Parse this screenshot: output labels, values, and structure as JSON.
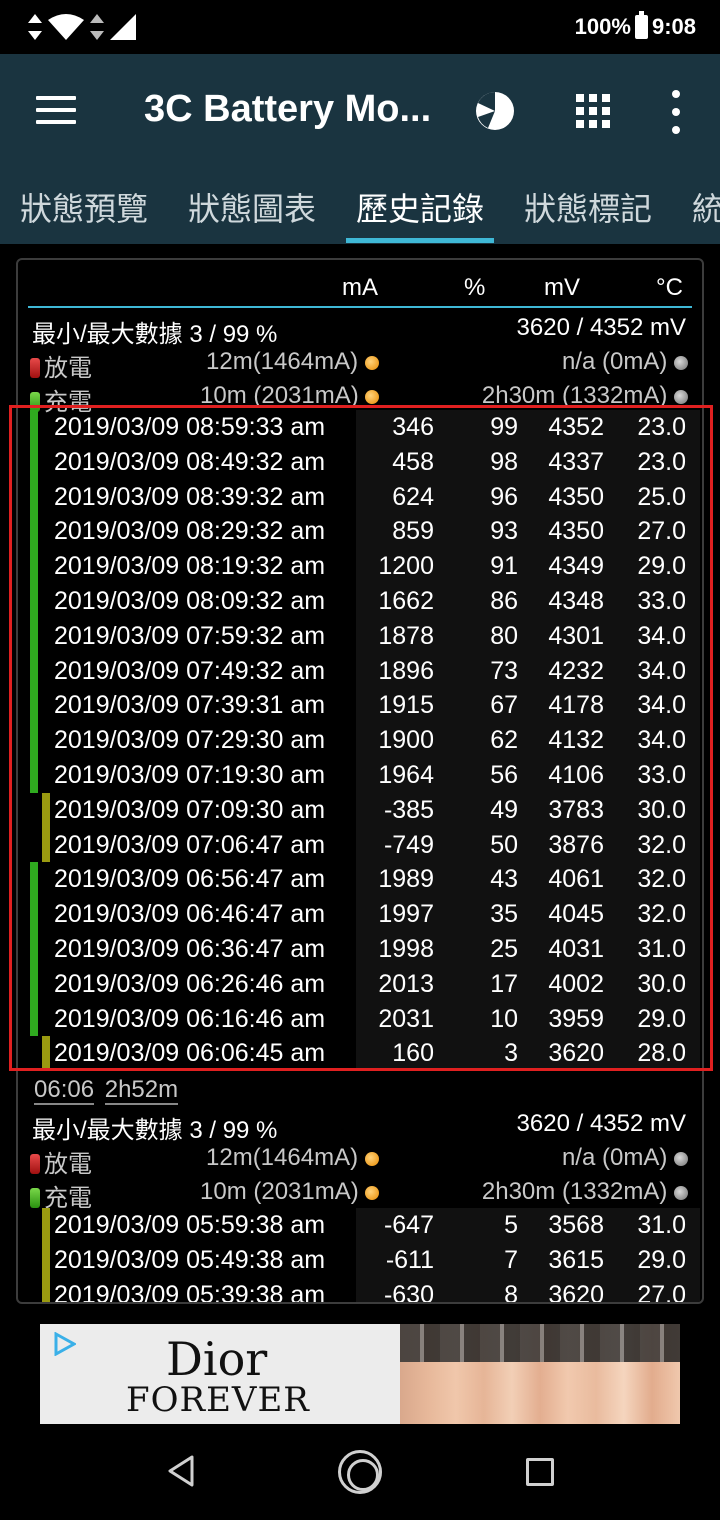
{
  "status_bar": {
    "battery_percent": "100%",
    "time": "9:08"
  },
  "app_bar": {
    "title": "3C Battery Mo..."
  },
  "tabs": [
    {
      "label": "狀態預覽"
    },
    {
      "label": "狀態圖表"
    },
    {
      "label": "歷史記錄",
      "active": true
    },
    {
      "label": "狀態標記"
    },
    {
      "label": "統"
    }
  ],
  "columns": {
    "ma": "mA",
    "pct": "%",
    "mv": "mV",
    "tc": "°C"
  },
  "summary1": {
    "minmax_label": "最小/最大數據",
    "minmax_pct": "3 / 99 %",
    "minmax_mv": "3620 / 4352 mV",
    "discharge_label": "放電",
    "discharge_value": "12m(1464mA)",
    "discharge_right": "n/a (0mA)",
    "charge_label": "充電",
    "charge_value": "10m (2031mA)",
    "charge_right": "2h30m (1332mA)"
  },
  "rows1": [
    {
      "dt": "2019/03/09  08:59:33 am",
      "ma": "346",
      "pct": "99",
      "mv": "4352",
      "tc": "23.0",
      "type": "charge"
    },
    {
      "dt": "2019/03/09  08:49:32 am",
      "ma": "458",
      "pct": "98",
      "mv": "4337",
      "tc": "23.0",
      "type": "charge"
    },
    {
      "dt": "2019/03/09  08:39:32 am",
      "ma": "624",
      "pct": "96",
      "mv": "4350",
      "tc": "25.0",
      "type": "charge"
    },
    {
      "dt": "2019/03/09  08:29:32 am",
      "ma": "859",
      "pct": "93",
      "mv": "4350",
      "tc": "27.0",
      "type": "charge"
    },
    {
      "dt": "2019/03/09  08:19:32 am",
      "ma": "1200",
      "pct": "91",
      "mv": "4349",
      "tc": "29.0",
      "type": "charge"
    },
    {
      "dt": "2019/03/09  08:09:32 am",
      "ma": "1662",
      "pct": "86",
      "mv": "4348",
      "tc": "33.0",
      "type": "charge"
    },
    {
      "dt": "2019/03/09  07:59:32 am",
      "ma": "1878",
      "pct": "80",
      "mv": "4301",
      "tc": "34.0",
      "type": "charge"
    },
    {
      "dt": "2019/03/09  07:49:32 am",
      "ma": "1896",
      "pct": "73",
      "mv": "4232",
      "tc": "34.0",
      "type": "charge"
    },
    {
      "dt": "2019/03/09  07:39:31 am",
      "ma": "1915",
      "pct": "67",
      "mv": "4178",
      "tc": "34.0",
      "type": "charge"
    },
    {
      "dt": "2019/03/09  07:29:30 am",
      "ma": "1900",
      "pct": "62",
      "mv": "4132",
      "tc": "34.0",
      "type": "charge"
    },
    {
      "dt": "2019/03/09  07:19:30 am",
      "ma": "1964",
      "pct": "56",
      "mv": "4106",
      "tc": "33.0",
      "type": "charge"
    },
    {
      "dt": "2019/03/09  07:09:30 am",
      "ma": "-385",
      "pct": "49",
      "mv": "3783",
      "tc": "30.0",
      "type": "discharge"
    },
    {
      "dt": "2019/03/09  07:06:47 am",
      "ma": "-749",
      "pct": "50",
      "mv": "3876",
      "tc": "32.0",
      "type": "discharge"
    },
    {
      "dt": "2019/03/09  06:56:47 am",
      "ma": "1989",
      "pct": "43",
      "mv": "4061",
      "tc": "32.0",
      "type": "charge"
    },
    {
      "dt": "2019/03/09  06:46:47 am",
      "ma": "1997",
      "pct": "35",
      "mv": "4045",
      "tc": "32.0",
      "type": "charge"
    },
    {
      "dt": "2019/03/09  06:36:47 am",
      "ma": "1998",
      "pct": "25",
      "mv": "4031",
      "tc": "31.0",
      "type": "charge"
    },
    {
      "dt": "2019/03/09  06:26:46 am",
      "ma": "2013",
      "pct": "17",
      "mv": "4002",
      "tc": "30.0",
      "type": "charge"
    },
    {
      "dt": "2019/03/09  06:16:46 am",
      "ma": "2031",
      "pct": "10",
      "mv": "3959",
      "tc": "29.0",
      "type": "charge"
    },
    {
      "dt": "2019/03/09  06:06:45 am",
      "ma": "160",
      "pct": "3",
      "mv": "3620",
      "tc": "28.0",
      "type": "discharge"
    }
  ],
  "gap": {
    "time": "06:06",
    "duration": "2h52m"
  },
  "summary2": {
    "minmax_label": "最小/最大數據",
    "minmax_pct": "3 / 99 %",
    "minmax_mv": "3620 / 4352 mV",
    "discharge_label": "放電",
    "discharge_value": "12m(1464mA)",
    "discharge_right": "n/a (0mA)",
    "charge_label": "充電",
    "charge_value": "10m (2031mA)",
    "charge_right": "2h30m (1332mA)"
  },
  "rows2": [
    {
      "dt": "2019/03/09  05:59:38 am",
      "ma": "-647",
      "pct": "5",
      "mv": "3568",
      "tc": "31.0",
      "type": "discharge"
    },
    {
      "dt": "2019/03/09  05:49:38 am",
      "ma": "-611",
      "pct": "7",
      "mv": "3615",
      "tc": "29.0",
      "type": "discharge"
    },
    {
      "dt": "2019/03/09  05:39:38 am",
      "ma": "-630",
      "pct": "8",
      "mv": "3620",
      "tc": "27.0",
      "type": "discharge"
    }
  ],
  "ad": {
    "brand": "Dior",
    "tagline": "FOREVER"
  },
  "colors": {
    "appbar": "#1a3440",
    "accent": "#3fb8d6",
    "charge": "#2faa1f",
    "discharge": "#9a9a10",
    "highlight": "#e02020"
  }
}
